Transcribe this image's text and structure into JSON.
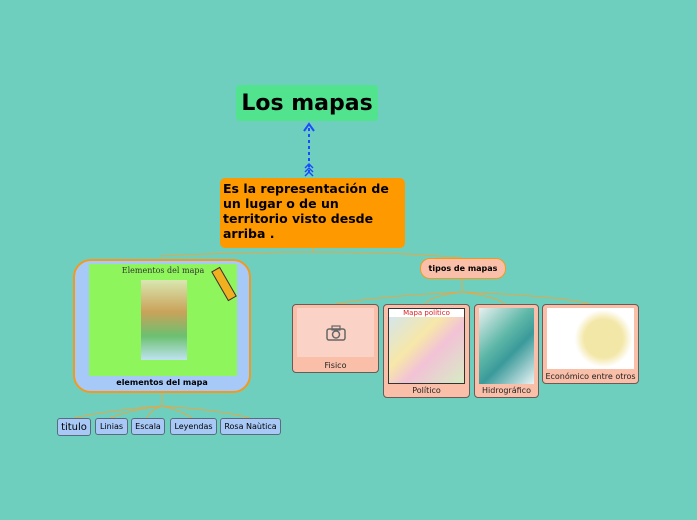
{
  "root": {
    "title": "Los mapas"
  },
  "definition": {
    "text": "Es la representación de un lugar o de un territorio  visto desde arriba ."
  },
  "elements_node": {
    "label": "elementos del mapa",
    "image_heading": "Elementos del mapa",
    "children": [
      "titulo",
      "Linias",
      "Escala",
      "Leyendas",
      "Rosa Naùtica"
    ]
  },
  "types_node": {
    "label": "tipos de mapas",
    "children": [
      {
        "label": "Fisico",
        "icon": "camera-icon"
      },
      {
        "label": "Político",
        "image_heading": "Mapa político"
      },
      {
        "label": "Hidrográfico"
      },
      {
        "label": "Económico entre otros"
      }
    ]
  },
  "colors": {
    "background": "#6fcfbf",
    "root": "#52e38f",
    "definition": "#ff9900",
    "elements": "#a7c9f7",
    "types": "#f9bfa9",
    "connector": "#e0a84a",
    "arrow": "#1a4cff"
  }
}
